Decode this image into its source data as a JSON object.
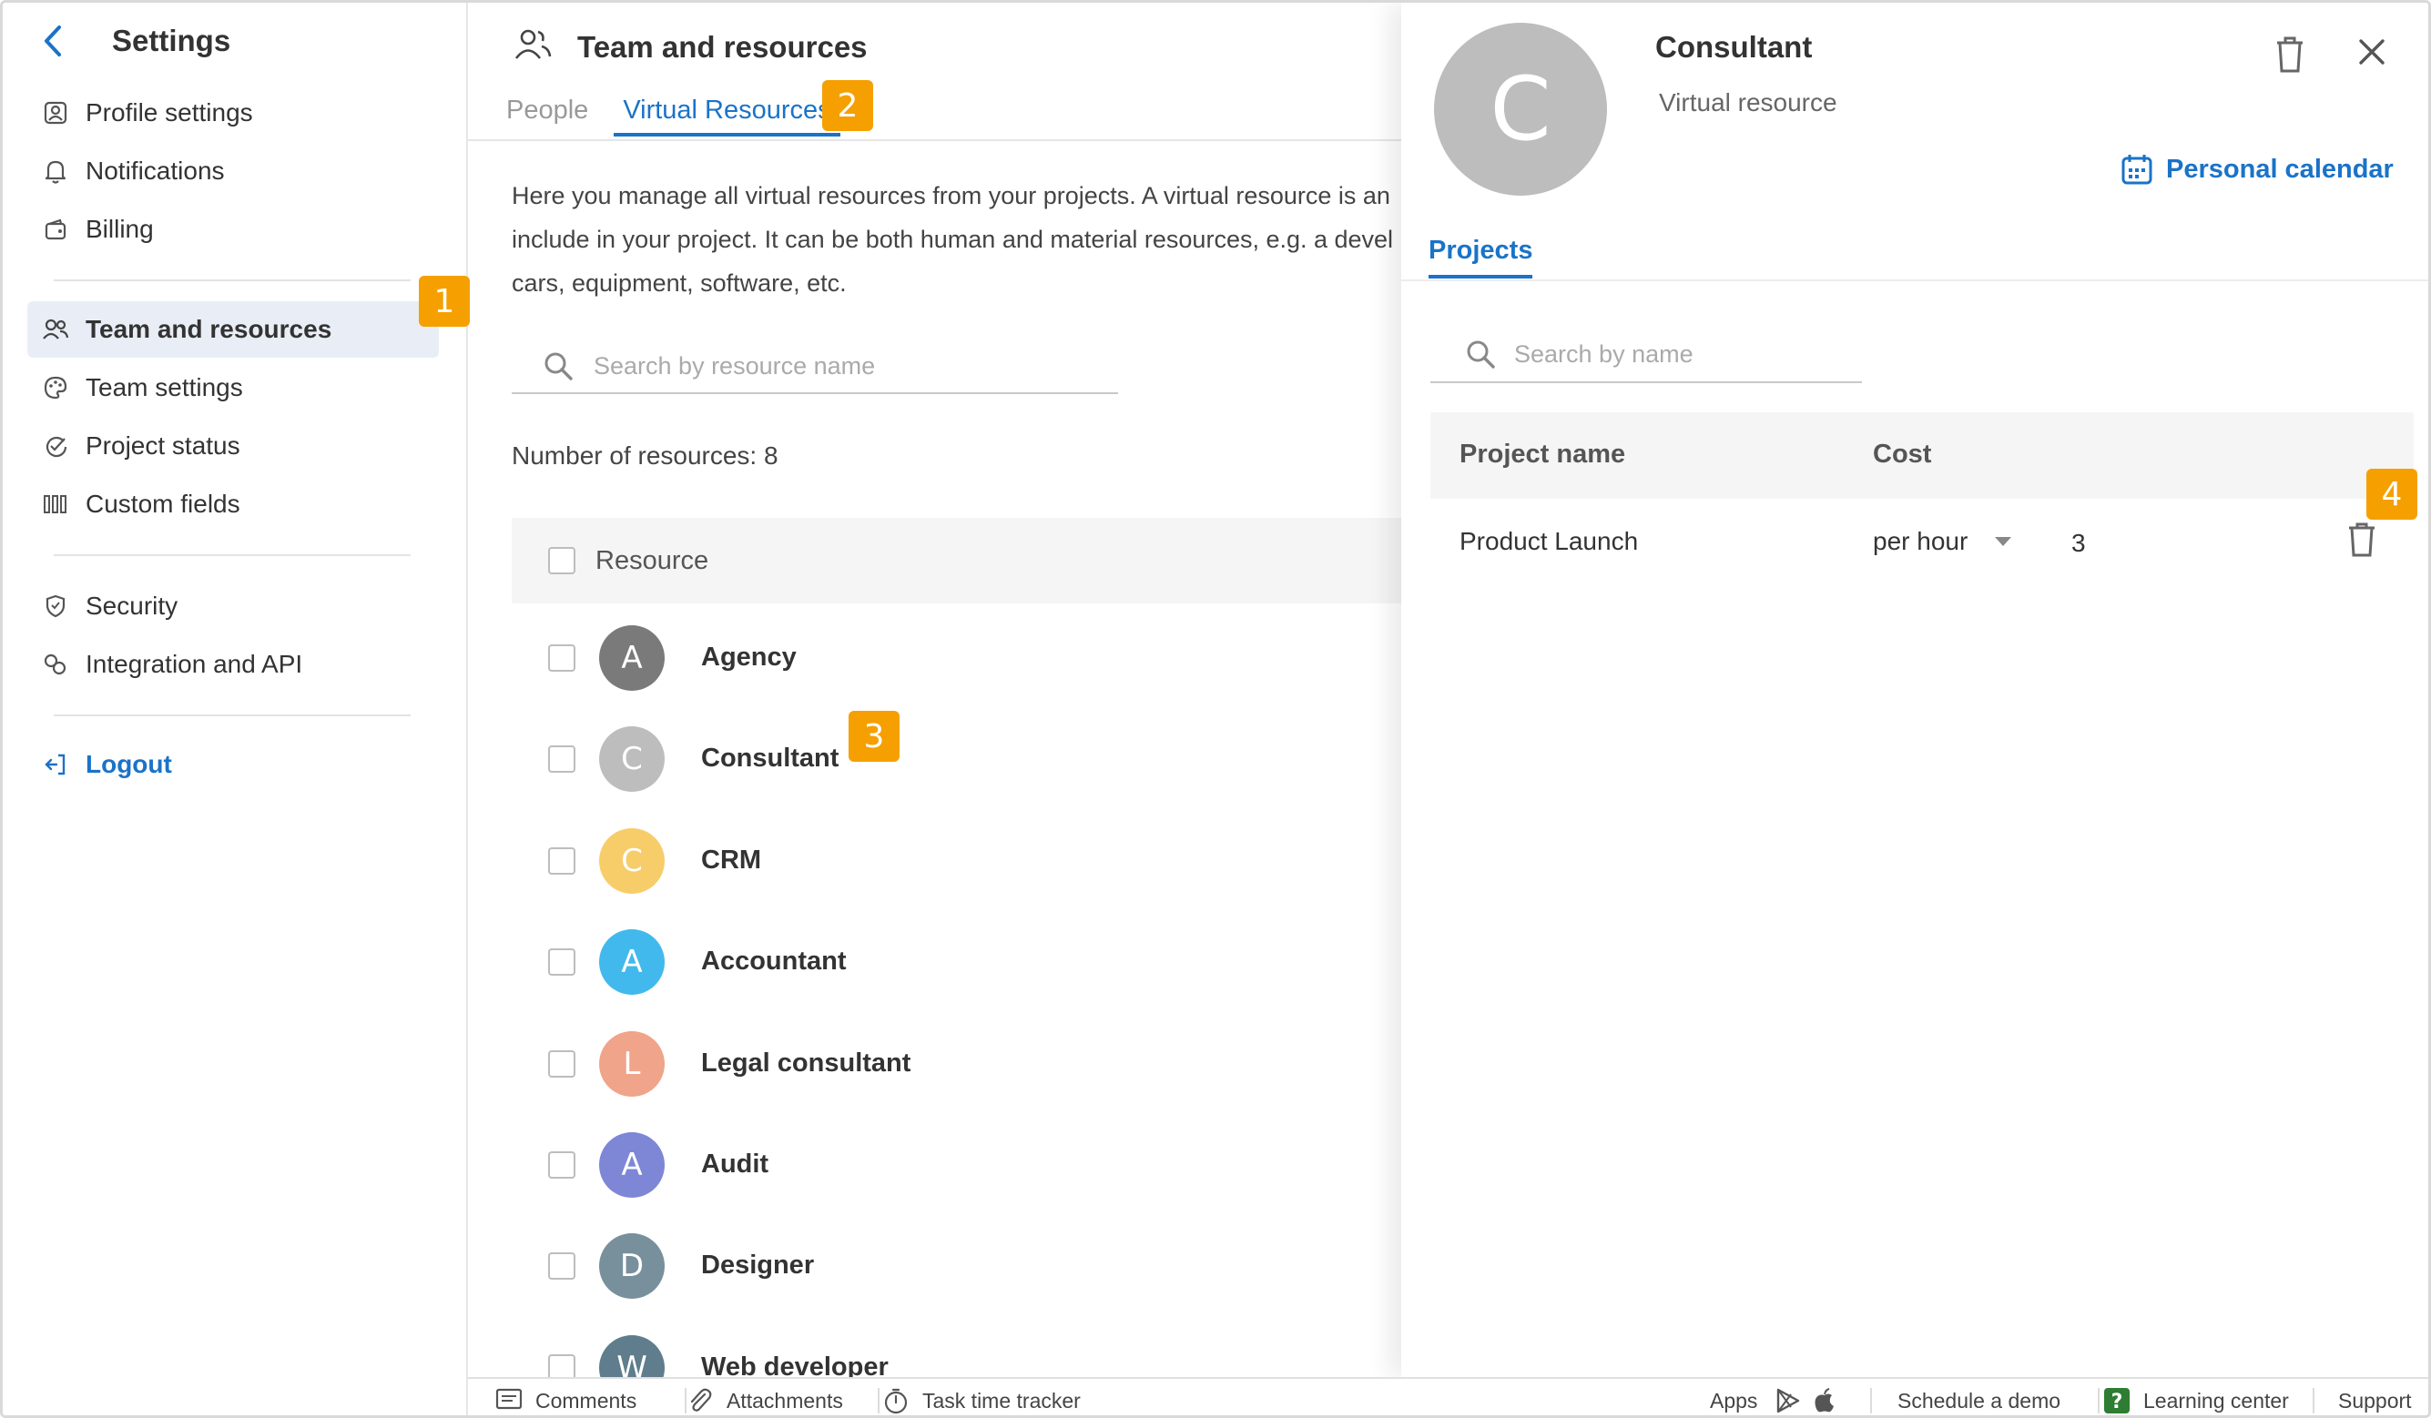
{
  "sidebar": {
    "title": "Settings",
    "items": [
      {
        "label": "Profile settings",
        "icon": "profile-icon"
      },
      {
        "label": "Notifications",
        "icon": "bell-icon"
      },
      {
        "label": "Billing",
        "icon": "wallet-icon"
      },
      {
        "label": "Team and resources",
        "icon": "team-icon"
      },
      {
        "label": "Team settings",
        "icon": "palette-icon"
      },
      {
        "label": "Project status",
        "icon": "status-icon"
      },
      {
        "label": "Custom fields",
        "icon": "columns-icon"
      },
      {
        "label": "Security",
        "icon": "shield-icon"
      },
      {
        "label": "Integration and API",
        "icon": "link-icon"
      }
    ],
    "logout": "Logout"
  },
  "badges": [
    "1",
    "2",
    "3",
    "4"
  ],
  "main": {
    "title": "Team and resources",
    "tabs": [
      "People",
      "Virtual Resources"
    ],
    "description_lines": [
      "Here you manage all virtual resources from your projects. A virtual resource is an",
      "include in your project. It can be both human and material resources, e.g. a devel",
      "cars, equipment, software, etc."
    ],
    "search_placeholder": "Search by resource name",
    "count_label": "Number of resources: 8",
    "column_resource": "Resource",
    "resources": [
      {
        "initial": "A",
        "name": "Agency",
        "color": "#7a7a7a"
      },
      {
        "initial": "C",
        "name": "Consultant",
        "color": "#bdbdbd"
      },
      {
        "initial": "C",
        "name": "CRM",
        "color": "#f7cd6a"
      },
      {
        "initial": "A",
        "name": "Accountant",
        "color": "#42b9ec"
      },
      {
        "initial": "L",
        "name": "Legal consultant",
        "color": "#f0a48a"
      },
      {
        "initial": "A",
        "name": "Audit",
        "color": "#7e86d6"
      },
      {
        "initial": "D",
        "name": "Designer",
        "color": "#78909c"
      },
      {
        "initial": "W",
        "name": "Web developer",
        "color": "#5f7d8c"
      }
    ]
  },
  "panel": {
    "initial": "C",
    "name": "Consultant",
    "type": "Virtual resource",
    "calendar_label": "Personal calendar",
    "tab": "Projects",
    "search_placeholder": "Search by name",
    "col_project": "Project name",
    "col_cost": "Cost",
    "rows": [
      {
        "project": "Product Launch",
        "unit": "per hour",
        "value": "3"
      }
    ]
  },
  "footer": {
    "comments": "Comments",
    "attachments": "Attachments",
    "tracker": "Task time tracker",
    "apps": "Apps",
    "demo": "Schedule a demo",
    "learning": "Learning center",
    "support": "Support"
  },
  "colors": {
    "accent": "#1a73c8",
    "badge": "#f5a000"
  }
}
